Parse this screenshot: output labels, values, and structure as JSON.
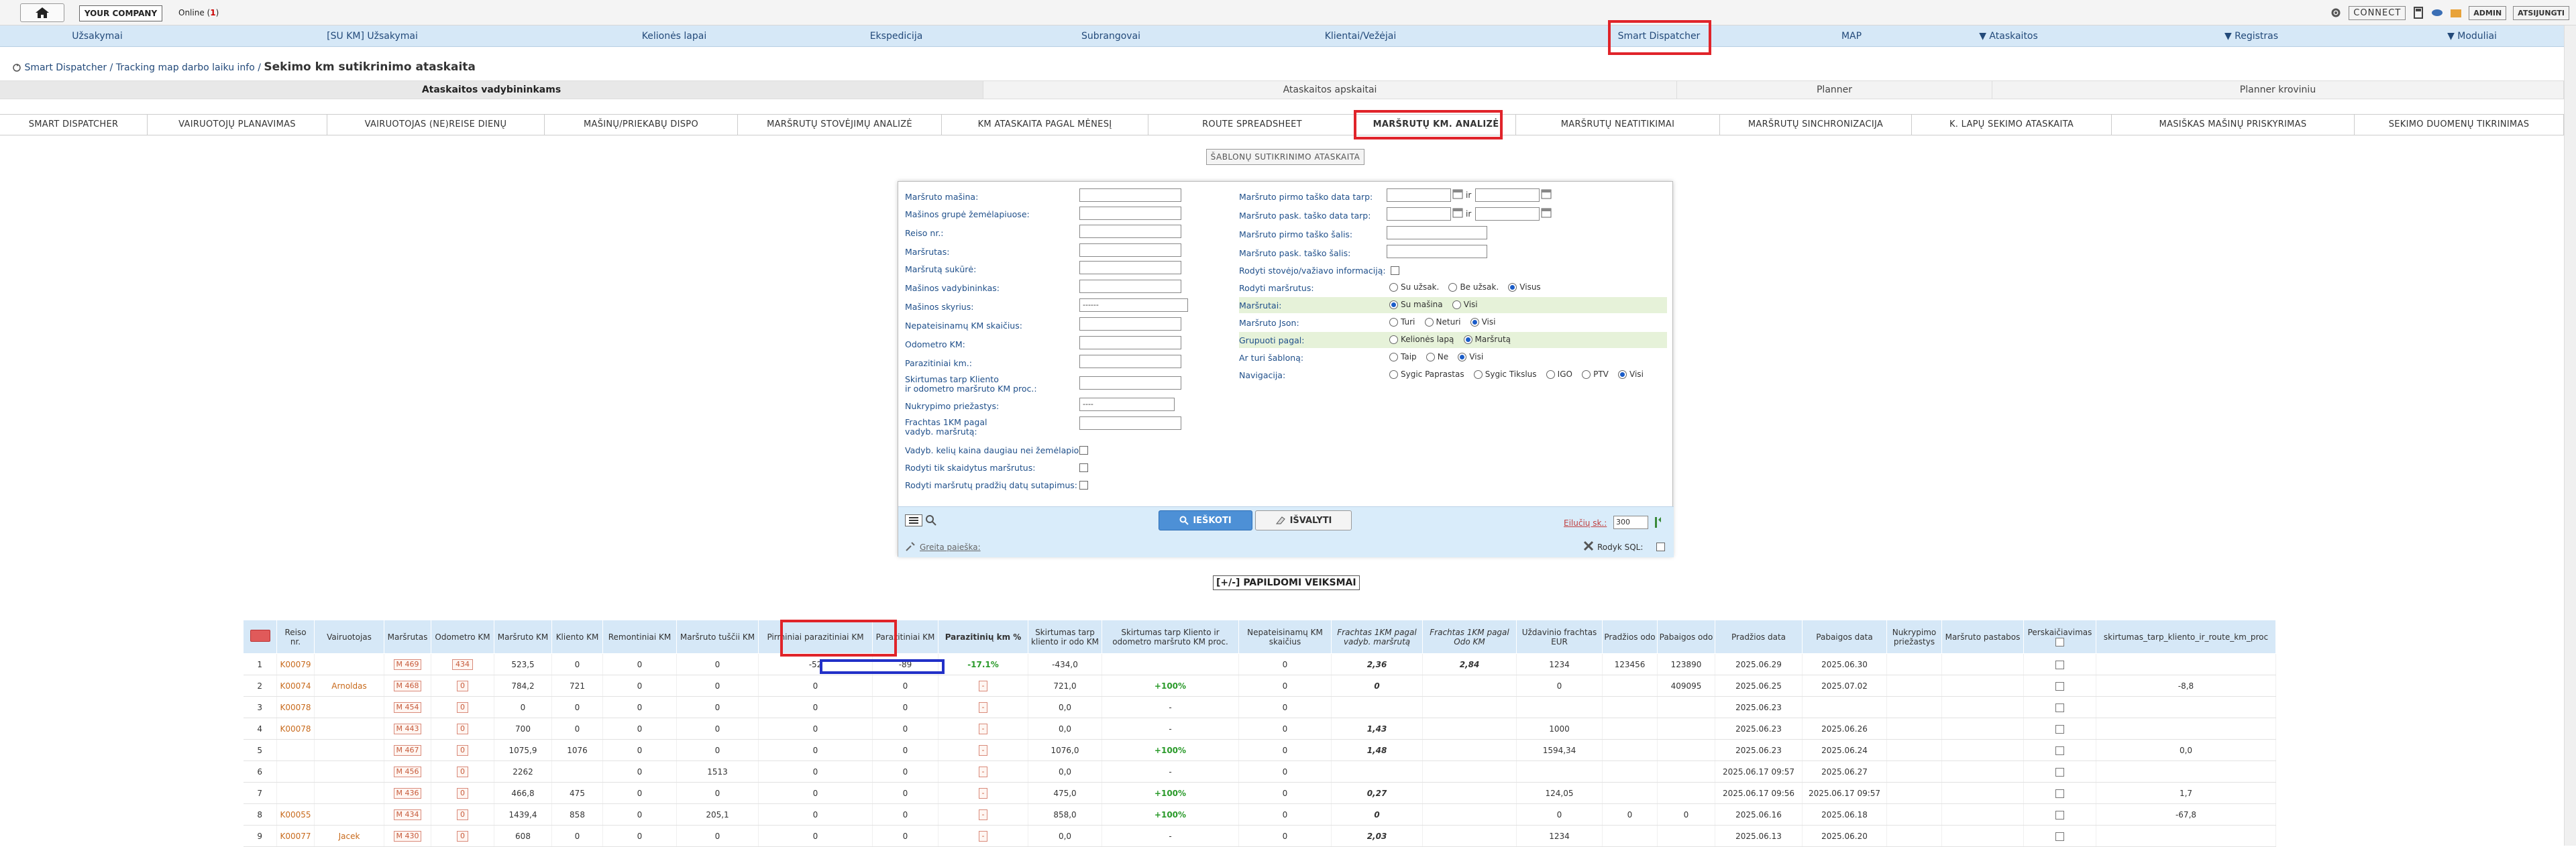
{
  "topbar": {
    "company": "YOUR COMPANY",
    "online_label": "Online (",
    "online_count": "1",
    "online_close": ")",
    "connect": "CONNECT",
    "admin": "ADMIN",
    "logout": "ATSIJUNGTI"
  },
  "mainnav": {
    "items": [
      "Užsakymai",
      "[SU KM] Užsakymai",
      "Kelionės lapai",
      "Ekspedicija",
      "Subrangovai",
      "Klientai/Vežėjai",
      "Smart Dispatcher",
      "MAP",
      "▼ Ataskaitos",
      "▼ Registras",
      "▼ Moduliai"
    ]
  },
  "breadcrumb": {
    "part1": "Smart Dispatcher",
    "sep1": " / ",
    "part2": "Tracking map darbo laiku info",
    "sep2": " / ",
    "current": "Sekimo km sutikrinimo ataskaita"
  },
  "tabs1": [
    "Ataskaitos vadybininkams",
    "Ataskaitos apskaitai",
    "Planner",
    "Planner kroviniu"
  ],
  "tabs2": [
    "SMART DISPATCHER",
    "VAIRUOTOJŲ PLANAVIMAS",
    "VAIRUOTOJAS (NE)REISE DIENŲ",
    "MAŠINŲ/PRIEKABŲ DISPO",
    "MARŠRUTŲ STOVĖJIMŲ ANALIZĖ",
    "KM ATASKAITA PAGAL MĖNESĮ",
    "ROUTE SPREADSHEET",
    "MARŠRUTŲ KM. ANALIZĖ",
    "MARŠRUTŲ NEATITIKIMAI",
    "MARŠRUTŲ SINCHRONIZACIJA",
    "K. LAPŲ SEKIMO ATASKAITA",
    "MASIŠKAS MAŠINŲ PRISKYRIMAS",
    "SEKIMO DUOMENŲ TIKRINIMAS"
  ],
  "template_button": "ŠABLONŲ SUTIKRINIMO ATASKAITA",
  "form": {
    "left_labels": [
      "Maršruto mašina:",
      "Mašinos grupė žemėlapiuose:",
      "Reiso nr.:",
      "Maršrutas:",
      "Maršrutą sukūrė:",
      "Mašinos vadybininkas:",
      "Mašinos skyrius:",
      "Nepateisinamų KM skaičius:",
      "Odometro KM:",
      "Parazitiniai km.:",
      "Skirtumas tarp Kliento",
      "ir odometro maršruto KM proc.:",
      "Nukrypimo priežastys:",
      "Frachtas 1KM pagal",
      "vadyb. maršrutą:",
      "Vadyb. kelių kaina daugiau nei žemėlapio:",
      "Rodyti tik skaidytus maršrutus:",
      "Rodyti maršrutų pradžių datų sutapimus:"
    ],
    "skyrius_value": "------",
    "nukrypimo_value": "----",
    "right_labels": [
      "Maršruto pirmo taško data tarp:",
      "Maršruto pask. taško data tarp:",
      "Maršruto pirmo taško šalis:",
      "Maršruto pask. taško šalis:",
      "Rodyti stovėjo/važiavo informaciją:",
      "Rodyti maršrutus:",
      "Maršrutai:",
      "Maršruto Json:",
      "Grupuoti pagal:",
      "Ar turi šabloną:",
      "Navigacija:"
    ],
    "ir": "ir",
    "r_marsrutus": [
      "Su užsak.",
      "Be užsak.",
      "Visus"
    ],
    "r_marsrutai": [
      "Su mašina",
      "Visi"
    ],
    "r_json": [
      "Turi",
      "Neturi",
      "Visi"
    ],
    "r_grupuoti": [
      "Kelionės lapą",
      "Maršrutą"
    ],
    "r_sablonas": [
      "Taip",
      "Ne",
      "Visi"
    ],
    "r_navigacija": [
      "Sygic Paprastas",
      "Sygic Tikslus",
      "IGO",
      "PTV",
      "Visi"
    ],
    "search_btn": "IEŠKOTI",
    "clear_btn": "IŠVALYTI",
    "rows_label": "Eilučių sk.:",
    "rows_value": "300",
    "quick_search": "Greita paieška:",
    "show_sql": "Rodyk SQL:"
  },
  "extra_actions": "[+/-] PAPILDOMI VEIKSMAI",
  "table": {
    "headers": [
      "",
      "Reiso nr.",
      "Vairuotojas",
      "Maršrutas",
      "Odometro KM",
      "Maršruto KM",
      "Kliento KM",
      "Remontiniai KM",
      "Maršruto tuščii KM",
      "Pirminiai parazitiniai KM",
      "Parazitiniai KM",
      "Parazitinių km %",
      "Skirtumas tarp kliento ir odo KM",
      "Skirtumas tarp Kliento ir odometro maršruto KM proc.",
      "Nepateisinamų KM skaičius",
      "Frachtas 1KM pagal vadyb. maršrutą",
      "Frachtas 1KM pagal Odo KM",
      "Uždavinio frachtas EUR",
      "Pradžios odo",
      "Pabaigos odo",
      "Pradžios data",
      "Pabaigos data",
      "Nukrypimo priežastys",
      "Maršruto pastabos",
      "Perskaičiavimas",
      "skirtumas_tarp_kliento_ir_route_km_proc"
    ],
    "rows": [
      [
        "1",
        "K00079",
        "",
        "M 469",
        "434",
        "523,5",
        "0",
        "0",
        "0",
        "-52",
        "-89",
        "-17.1%",
        "-434,0",
        "",
        "0",
        "2,36",
        "2,84",
        "1234",
        "123456",
        "123890",
        "2025.06.29",
        "2025.06.30",
        "",
        "",
        "",
        ""
      ],
      [
        "2",
        "K00074",
        "Arnoldas",
        "M 468",
        "0",
        "784,2",
        "721",
        "0",
        "0",
        "0",
        "0",
        "-",
        "721,0",
        "+100%",
        "0",
        "0",
        "",
        "0",
        "",
        "409095",
        "2025.06.25",
        "2025.07.02",
        "",
        "",
        "",
        "-8,8"
      ],
      [
        "3",
        "K00078",
        "",
        "M 454",
        "0",
        "0",
        "0",
        "0",
        "0",
        "0",
        "0",
        "-",
        "0,0",
        "-",
        "0",
        "",
        "",
        "",
        "",
        "",
        "2025.06.23",
        "",
        "",
        "",
        "",
        ""
      ],
      [
        "4",
        "K00078",
        "",
        "M 443",
        "0",
        "700",
        "0",
        "0",
        "0",
        "0",
        "0",
        "-",
        "0,0",
        "-",
        "0",
        "1,43",
        "",
        "1000",
        "",
        "",
        "2025.06.23",
        "2025.06.26",
        "",
        "",
        "",
        ""
      ],
      [
        "5",
        "",
        "",
        "M 467",
        "0",
        "1075,9",
        "1076",
        "0",
        "0",
        "0",
        "0",
        "-",
        "1076,0",
        "+100%",
        "0",
        "1,48",
        "",
        "1594,34",
        "",
        "",
        "2025.06.23",
        "2025.06.24",
        "",
        "",
        "",
        "0,0"
      ],
      [
        "6",
        "",
        "",
        "M 456",
        "0",
        "2262",
        "",
        "0",
        "1513",
        "0",
        "0",
        "-",
        "0,0",
        "-",
        "0",
        "",
        "",
        "",
        "",
        "",
        "2025.06.17 09:57",
        "2025.06.27",
        "",
        "",
        "",
        ""
      ],
      [
        "7",
        "",
        "",
        "M 436",
        "0",
        "466,8",
        "475",
        "0",
        "0",
        "0",
        "0",
        "-",
        "475,0",
        "+100%",
        "0",
        "0,27",
        "",
        "124,05",
        "",
        "",
        "2025.06.17 09:56",
        "2025.06.17 09:57",
        "",
        "",
        "",
        "1,7"
      ],
      [
        "8",
        "K00055",
        "",
        "M 434",
        "0",
        "1439,4",
        "858",
        "0",
        "205,1",
        "0",
        "0",
        "-",
        "858,0",
        "+100%",
        "0",
        "0",
        "",
        "0",
        "0",
        "0",
        "2025.06.16",
        "2025.06.18",
        "",
        "",
        "",
        "-67,8"
      ],
      [
        "9",
        "K00077",
        "Jacek",
        "M 430",
        "0",
        "608",
        "0",
        "0",
        "0",
        "0",
        "0",
        "-",
        "0,0",
        "-",
        "0",
        "2,03",
        "",
        "1234",
        "",
        "",
        "2025.06.13",
        "2025.06.20",
        "",
        "",
        "",
        ""
      ]
    ]
  },
  "colors": {
    "nav_bg": "#d6e8f7",
    "highlight_red": "#e0242a",
    "highlight_blue": "#2230c8",
    "link_orange": "#c86a1c",
    "green": "#2a9a2a",
    "search_btn": "#4d90d6"
  }
}
